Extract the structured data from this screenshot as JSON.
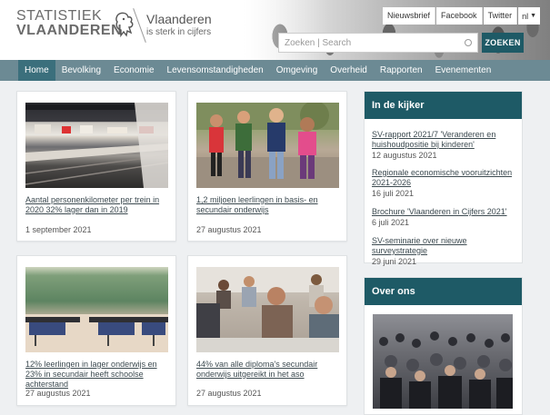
{
  "header": {
    "logo_line1": "STATISTIEK",
    "logo_line2": "VLAANDEREN",
    "brand_title": "Vlaanderen",
    "brand_subtitle": "is sterk in cijfers",
    "top_links": [
      "Nieuwsbrief",
      "Facebook",
      "Twitter"
    ],
    "language": "nl",
    "search_placeholder": "Zoeken | Search",
    "search_button": "ZOEKEN"
  },
  "nav": {
    "items": [
      "Home",
      "Bevolking",
      "Economie",
      "Levensomstandigheden",
      "Omgeving",
      "Overheid",
      "Rapporten",
      "Evenementen"
    ],
    "active": "Home"
  },
  "cards": [
    {
      "title": "Aantal personenkilometer per trein in 2020 32% lager dan in 2019",
      "date": "1 september 2021",
      "image": "train-station-photo"
    },
    {
      "title": "1,2 miljoen leerlingen in basis- en secundair onderwijs",
      "date": "27 augustus 2021",
      "image": "children-walking-photo"
    },
    {
      "title": "12% leerlingen in lager onderwijs en 23% in secundair heeft schoolse achterstand",
      "date": "27 augustus 2021",
      "image": "classroom-photo"
    },
    {
      "title": "44% van alle diploma's secundair onderwijs uitgereikt in het aso",
      "date": "27 augustus 2021",
      "image": "students-exam-photo"
    }
  ],
  "sidebar": {
    "in_de_kijker": {
      "heading": "In de kijker",
      "items": [
        {
          "title": "SV-rapport 2021/7 'Veranderen en huishoudpositie bij kinderen'",
          "date": "12 augustus 2021"
        },
        {
          "title": "Regionale economische vooruitzichten 2021-2026",
          "date": "16 juli 2021"
        },
        {
          "title": "Brochure 'Vlaanderen in Cijfers 2021'",
          "date": "6 juli 2021"
        },
        {
          "title": "SV-seminarie over nieuwe surveystrategie",
          "date": "29 juni 2021"
        }
      ]
    },
    "over_ons": {
      "heading": "Over ons",
      "image": "crowd-photo"
    }
  },
  "colors": {
    "brand_dark": "#1e5a66",
    "nav_bg": "#6c8a94",
    "nav_active": "#3b6f7c",
    "page_bg": "#eef0f2"
  }
}
